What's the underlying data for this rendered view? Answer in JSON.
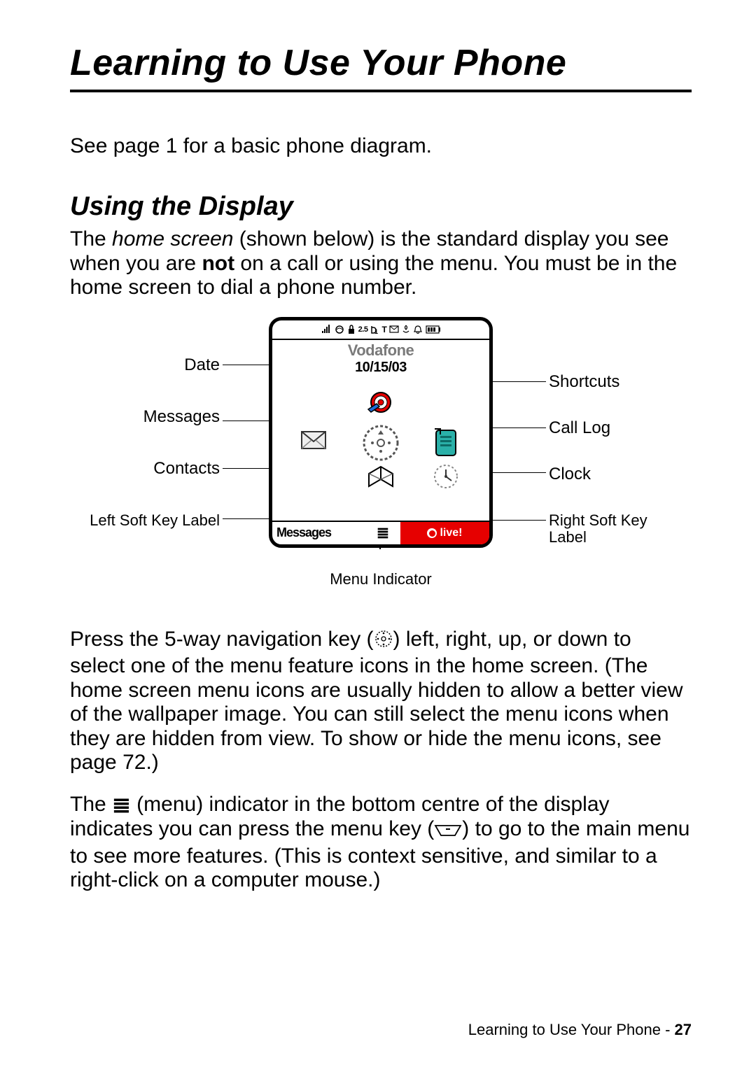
{
  "chapter_title": "Learning to Use Your Phone",
  "intro_text": "See page 1 for a basic phone diagram.",
  "section_title": "Using the Display",
  "para1_pre": "The ",
  "para1_em": "home screen",
  "para1_mid": " (shown below) is the standard display you see when you are ",
  "para1_bold": "not",
  "para1_post": " on a call or using the menu. You must be in the home screen to dial a phone number.",
  "diagram": {
    "status_bar_text": "ıııl  G  2.5  1  T   △  ▣",
    "carrier": "Vodafone",
    "date": "10/15/03",
    "left_softkey": "Messages",
    "menu_glyph": "≣",
    "right_softkey": "live!",
    "labels": {
      "date": "Date",
      "messages": "Messages",
      "contacts": "Contacts",
      "left_soft": "Left Soft Key Label",
      "shortcuts": "Shortcuts",
      "call_log": "Call Log",
      "clock": "Clock",
      "right_soft": "Right Soft Key Label",
      "menu_indicator": "Menu Indicator"
    }
  },
  "para2": "Press the 5-way navigation key (  ) left, right, up, or down to select one of the menu feature icons in the home screen. (The home screen menu icons are usually hidden to allow a better view of the wallpaper image. You can still select the menu icons when they are hidden from view. To show or hide the menu icons, see page 72.)",
  "para2_pre": "Press the 5-way navigation key (",
  "para2_post": ") left, right, up, or down to select one of the menu feature icons in the home screen. (The home screen menu icons are usually hidden to allow a better view of the wallpaper image. You can still select the menu icons when they are hidden from view. To show or hide the menu icons, see page 72.)",
  "para3_pre": "The ",
  "para3_glyph": "≣",
  "para3_mid": " (menu) indicator in the bottom centre of the display indicates you can press the menu key (",
  "para3_post": ") to go to the main menu to see more features. (This is context sensitive, and similar to a right-click on a computer mouse.)",
  "footer_text": "Learning to Use Your Phone - ",
  "footer_page": "27"
}
